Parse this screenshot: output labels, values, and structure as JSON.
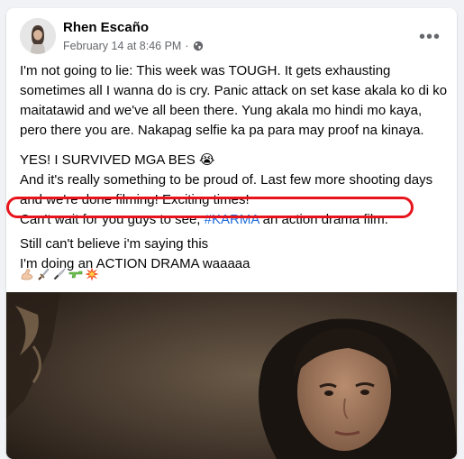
{
  "post": {
    "author": "Rhen Escaño",
    "timestamp": "February 14 at 8:46 PM",
    "separator": "·",
    "privacy_icon": "globe-icon",
    "more_icon": "more-horizontal-icon",
    "more_label": "•••",
    "paragraph1": "I'm not going to lie: This week was TOUGH. It gets exhausting sometimes all I wanna do is cry. Panic attack on set kase akala ko di ko maitatawid and we've all been there. Yung akala mo hindi mo kaya, pero there you are. Nakapag selfie ka pa para may proof na kinaya.",
    "line_survived": "YES! I SURVIVED MGA BES",
    "line_survived_emoji": "😭",
    "line_proud": "And it's really something to be proud of. Last few more shooting days and we're done filming! Exciting times!",
    "line_cant_wait_pre": "Can't wait for you guys to see, ",
    "hashtag": "#KARMA",
    "line_cant_wait_post": " an action drama film.",
    "line_still": "Still can't believe i'm saying this",
    "line_action": "I'm doing an ACTION DRAMA waaaaa",
    "emoji_icons": [
      "flexed-arm-icon",
      "dagger-icon",
      "knife-icon",
      "water-pistol-icon",
      "collision-icon"
    ]
  },
  "colors": {
    "highlight": "#e8141c",
    "hashtag": "#216fdb",
    "text": "#050505",
    "muted": "#65676b"
  }
}
